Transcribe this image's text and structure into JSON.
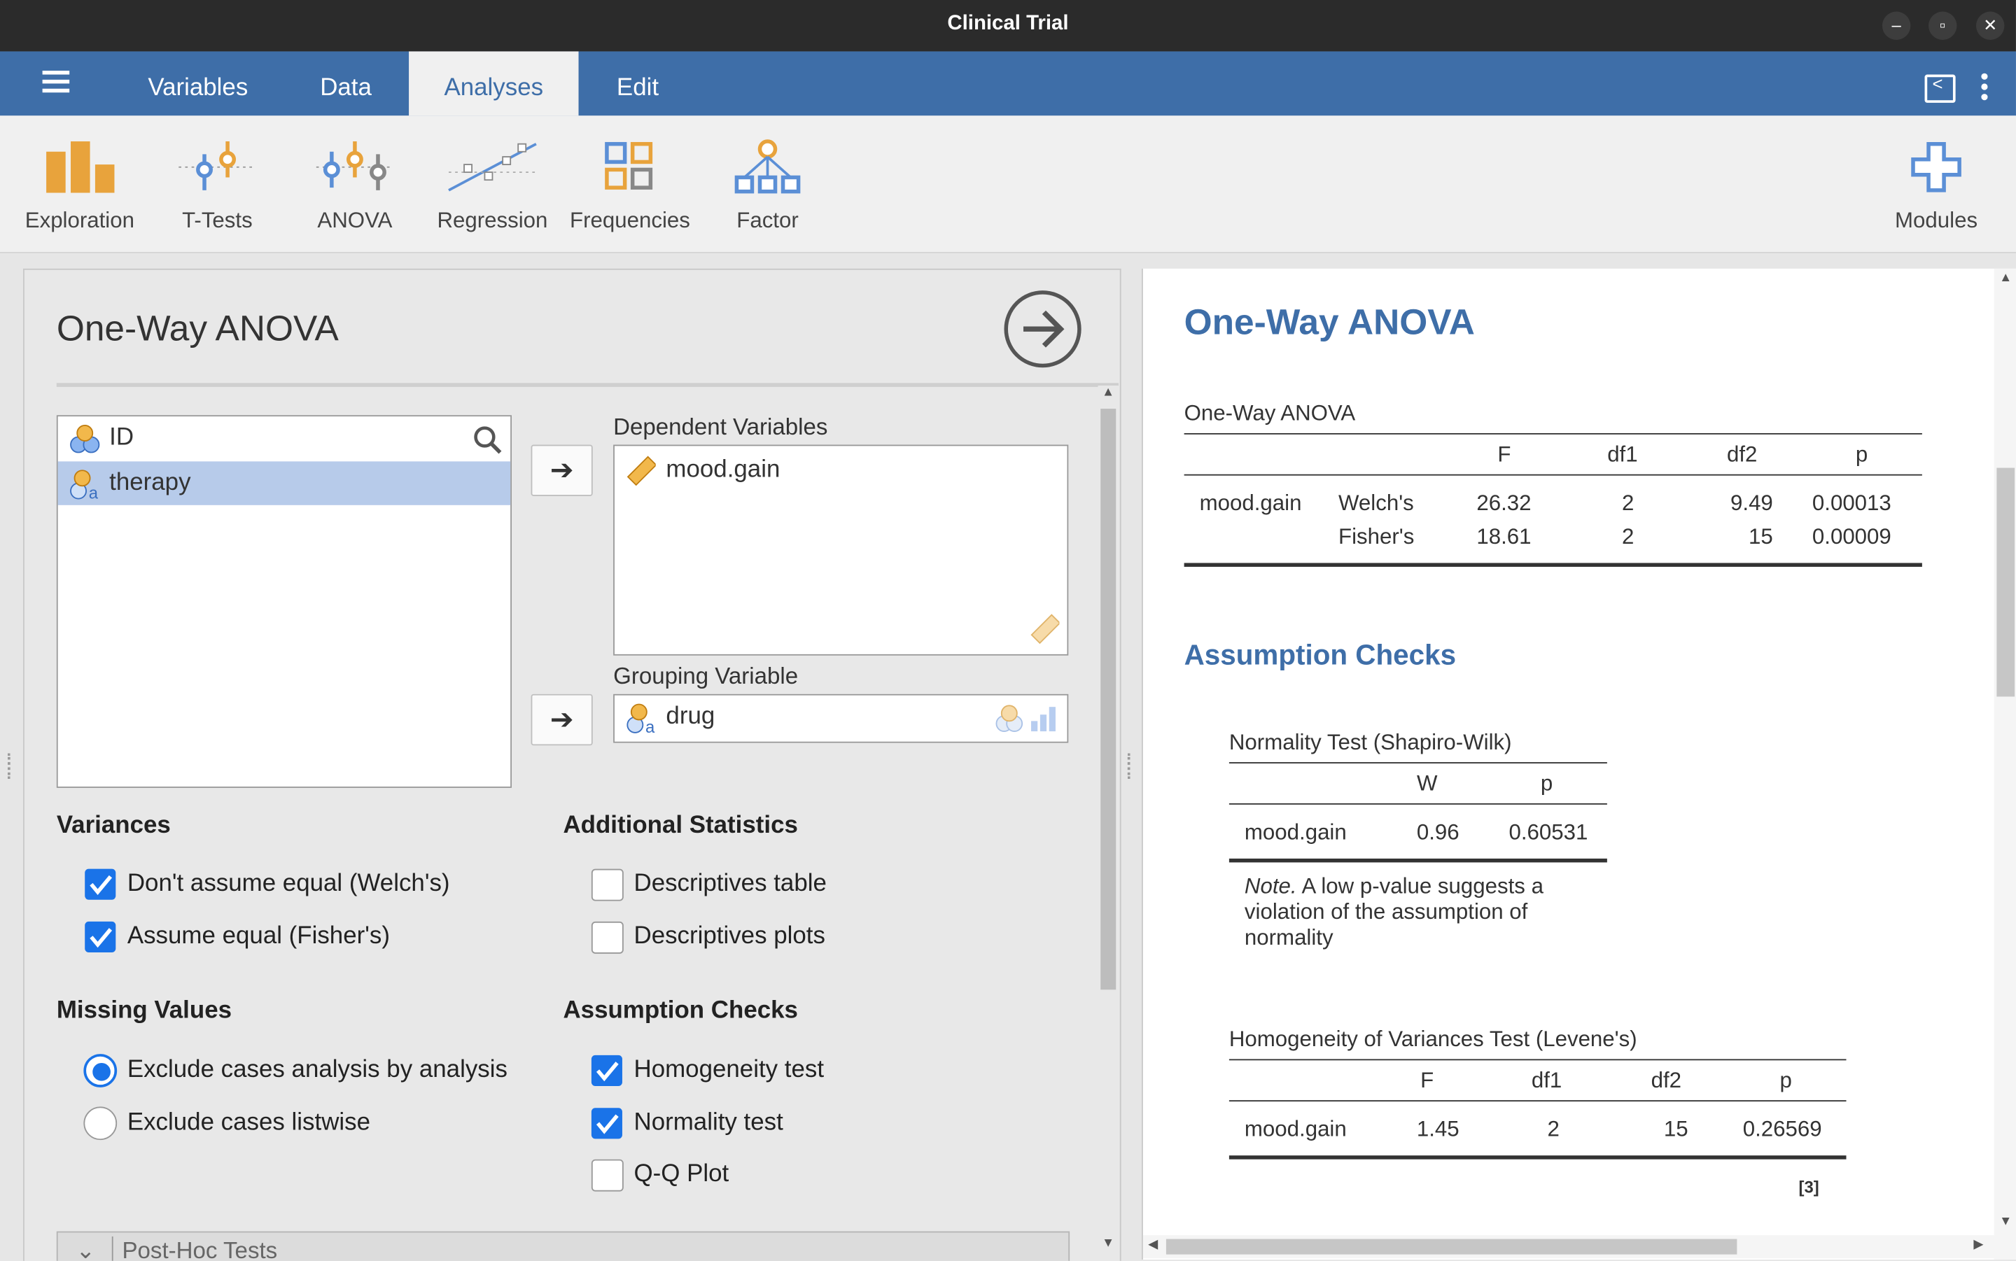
{
  "window": {
    "title": "Clinical Trial"
  },
  "nav": {
    "tabs": [
      {
        "label": "Variables"
      },
      {
        "label": "Data"
      },
      {
        "label": "Analyses"
      },
      {
        "label": "Edit"
      }
    ],
    "active_tab": "Analyses"
  },
  "ribbon": {
    "buttons": [
      {
        "label": "Exploration",
        "icon": "exploration-icon"
      },
      {
        "label": "T-Tests",
        "icon": "ttests-icon"
      },
      {
        "label": "ANOVA",
        "icon": "anova-icon"
      },
      {
        "label": "Regression",
        "icon": "regression-icon"
      },
      {
        "label": "Frequencies",
        "icon": "frequencies-icon"
      },
      {
        "label": "Factor",
        "icon": "factor-icon"
      }
    ],
    "modules_label": "Modules"
  },
  "options": {
    "title": "One-Way ANOVA",
    "available_variables": [
      {
        "name": "ID",
        "selected": false
      },
      {
        "name": "therapy",
        "selected": true
      }
    ],
    "dependent_label": "Dependent Variables",
    "dependent_variables": [
      "mood.gain"
    ],
    "grouping_label": "Grouping Variable",
    "grouping_variable": "drug",
    "variances": {
      "heading": "Variances",
      "welch": {
        "label": "Don't assume equal (Welch's)",
        "checked": true
      },
      "fisher": {
        "label": "Assume equal (Fisher's)",
        "checked": true
      }
    },
    "additional": {
      "heading": "Additional Statistics",
      "desc_table": {
        "label": "Descriptives table",
        "checked": false
      },
      "desc_plots": {
        "label": "Descriptives plots",
        "checked": false
      }
    },
    "missing": {
      "heading": "Missing Values",
      "analysis": {
        "label": "Exclude cases analysis by analysis",
        "selected": true
      },
      "listwise": {
        "label": "Exclude cases listwise",
        "selected": false
      }
    },
    "assumptions": {
      "heading": "Assumption Checks",
      "homogeneity": {
        "label": "Homogeneity test",
        "checked": true
      },
      "normality": {
        "label": "Normality test",
        "checked": true
      },
      "qq": {
        "label": "Q-Q Plot",
        "checked": false
      }
    },
    "posthoc_label": "Post-Hoc Tests"
  },
  "results": {
    "title": "One-Way ANOVA",
    "anova_table": {
      "caption": "One-Way ANOVA",
      "headers": [
        "F",
        "df1",
        "df2",
        "p"
      ],
      "dv": "mood.gain",
      "rows": [
        {
          "test": "Welch's",
          "F": "26.32",
          "df1": "2",
          "df2": "9.49",
          "p": "0.00013"
        },
        {
          "test": "Fisher's",
          "F": "18.61",
          "df1": "2",
          "df2": "15",
          "p": "0.00009"
        }
      ]
    },
    "assumption_heading": "Assumption Checks",
    "normality_table": {
      "caption": "Normality Test (Shapiro-Wilk)",
      "headers": [
        "W",
        "p"
      ],
      "row": {
        "var": "mood.gain",
        "W": "0.96",
        "p": "0.60531"
      },
      "note_label": "Note.",
      "note_text": "A low p-value suggests a violation of the assumption of normality"
    },
    "levene_table": {
      "caption": "Homogeneity of Variances Test (Levene's)",
      "headers": [
        "F",
        "df1",
        "df2",
        "p"
      ],
      "row": {
        "var": "mood.gain",
        "F": "1.45",
        "df1": "2",
        "df2": "15",
        "p": "0.26569"
      }
    },
    "ref": "[3]"
  },
  "colors": {
    "accent": "#3e6ea8",
    "check": "#1a73e8",
    "orange": "#e8a33c"
  }
}
